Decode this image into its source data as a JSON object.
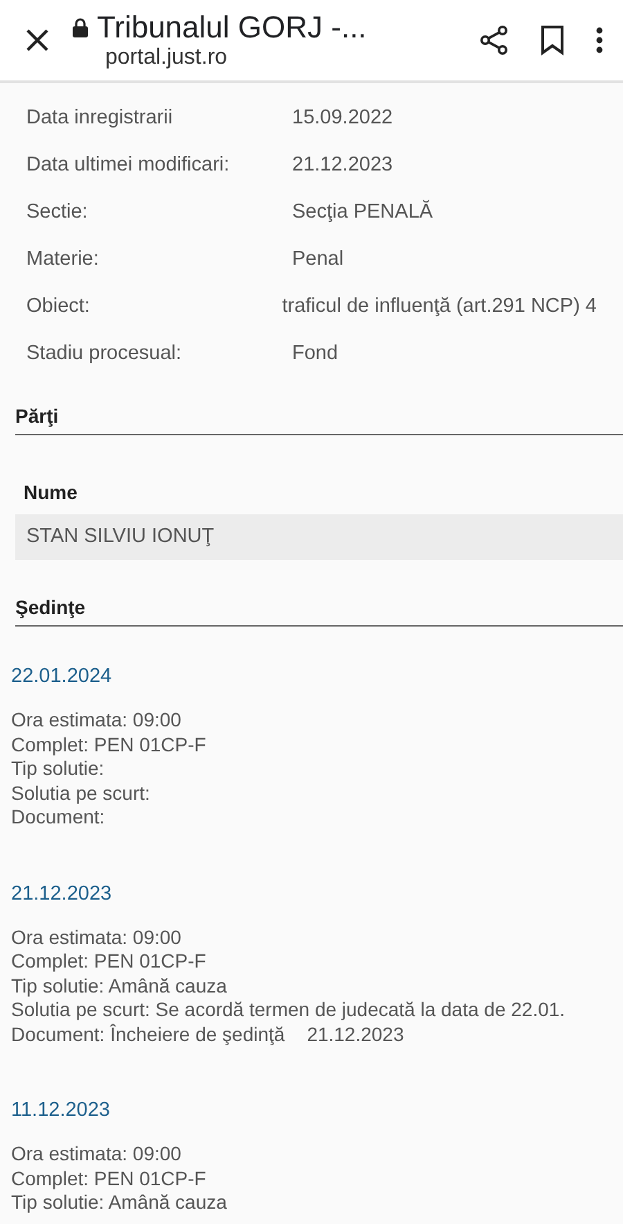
{
  "browser": {
    "title": "Tribunalul GORJ -...",
    "url": "portal.just.ro"
  },
  "details": [
    {
      "label": "Data inregistrarii",
      "value": "15.09.2022"
    },
    {
      "label": "Data ultimei modificari:",
      "value": "21.12.2023"
    },
    {
      "label": "Sectie:",
      "value": "Secţia PENALĂ"
    },
    {
      "label": "Materie:",
      "value": "Penal"
    },
    {
      "label": "Obiect:",
      "value": "traficul de influenţă (art.291 NCP) 4"
    },
    {
      "label": "Stadiu procesual:",
      "value": "Fond"
    }
  ],
  "parti": {
    "heading": "Părţi",
    "column": "Nume",
    "rows": [
      "STAN SILVIU IONUŢ"
    ]
  },
  "sedinte": {
    "heading": "Şedinţe",
    "items": [
      {
        "date": "22.01.2024",
        "lines": [
          {
            "text": "Ora estimata: 09:00"
          },
          {
            "text": "Complet: PEN 01CP-F"
          },
          {
            "text": "Tip solutie:"
          },
          {
            "text": "Solutia pe scurt:"
          },
          {
            "text": "Document:"
          }
        ]
      },
      {
        "date": "21.12.2023",
        "lines": [
          {
            "text": "Ora estimata: 09:00"
          },
          {
            "text": "Complet: PEN 01CP-F"
          },
          {
            "text": "Tip solutie: Amână cauza"
          },
          {
            "text": "Solutia pe scurt: Se acordă termen de judecată la data de 22.01."
          },
          {
            "text": "Document: Încheiere de şedinţă",
            "extra": "21.12.2023"
          }
        ]
      },
      {
        "date": "11.12.2023",
        "lines": [
          {
            "text": "Ora estimata: 09:00"
          },
          {
            "text": "Complet: PEN 01CP-F"
          },
          {
            "text": "Tip solutie: Amână cauza"
          }
        ]
      }
    ]
  }
}
